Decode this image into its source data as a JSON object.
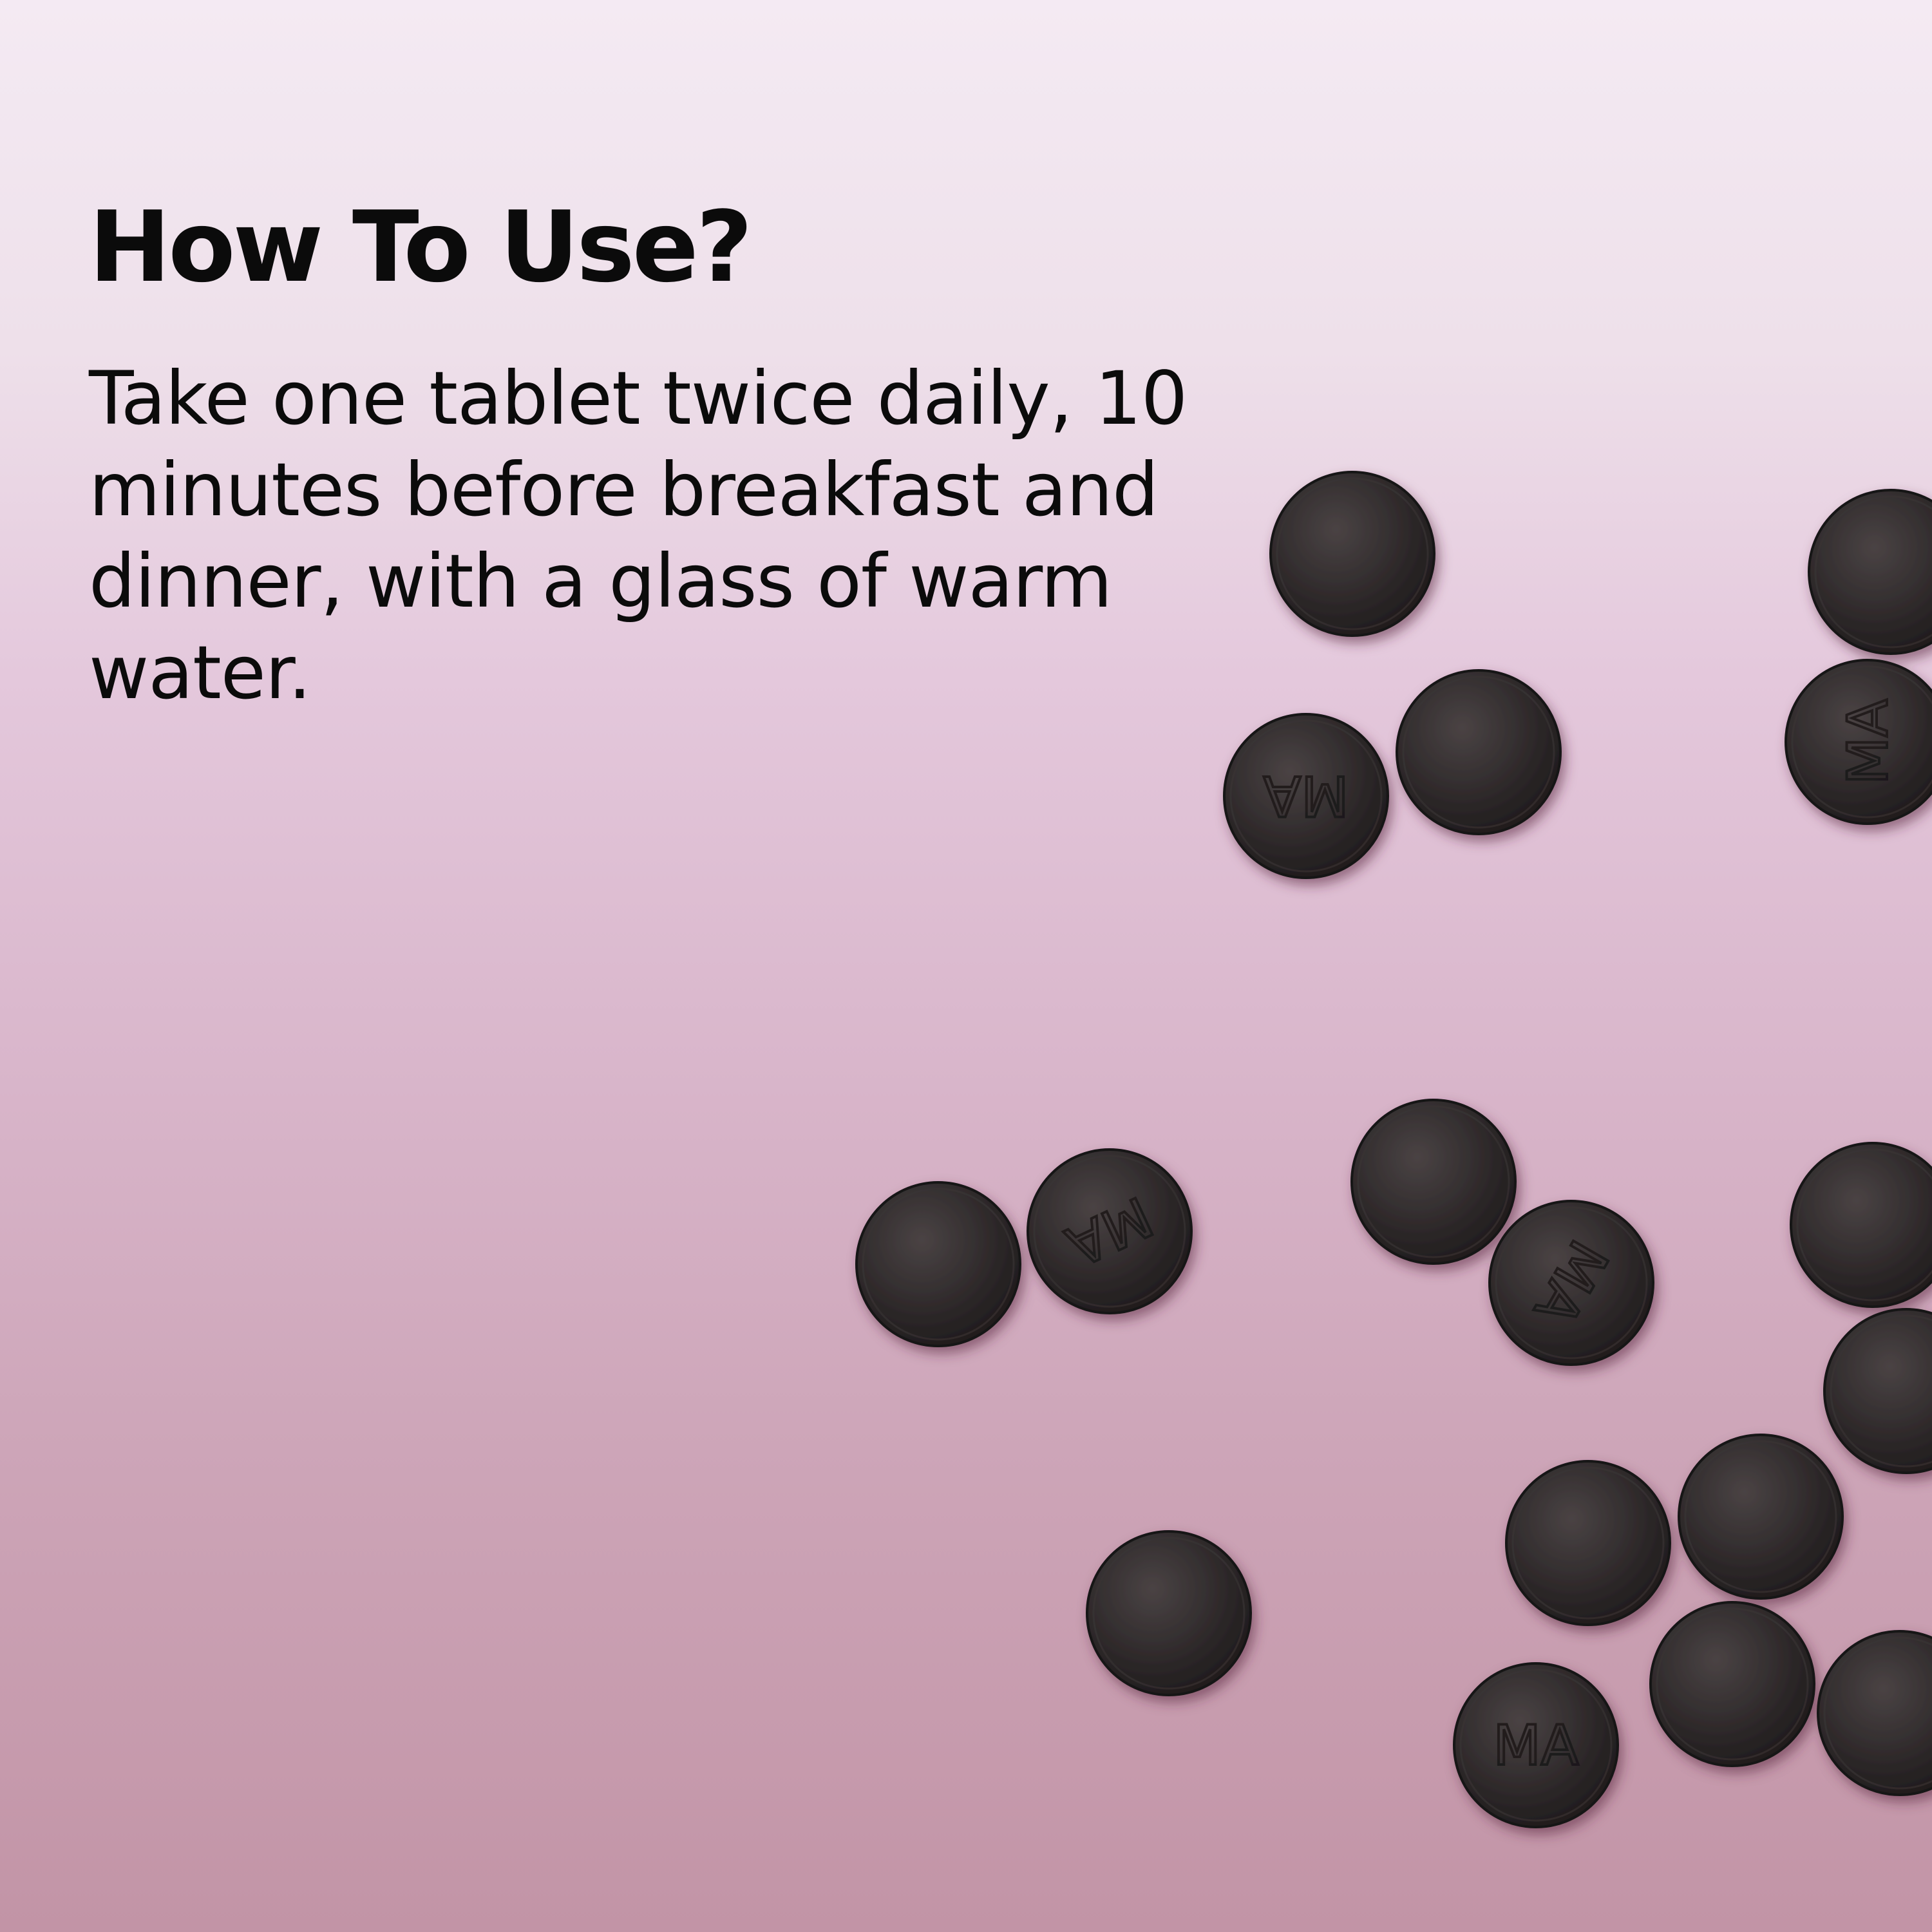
{
  "heading": "How To Use?",
  "instructions": "Take one tablet twice daily, 10 minutes before breakfast and dinner, with a glass of warm water.",
  "tablet_imprint": "MA",
  "colors": {
    "text": "#0b0b0b",
    "tablet": "#2e2a2b",
    "background_top": "#f4eaf3",
    "background_bottom": "#c294a6"
  }
}
